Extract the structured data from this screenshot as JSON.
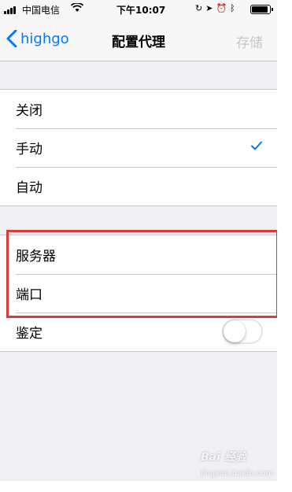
{
  "status_bar": {
    "carrier": "中国电信",
    "time": "下午10:07",
    "icons": [
      "orientation-lock-icon",
      "location-icon",
      "alarm-icon",
      "bluetooth-icon"
    ],
    "battery_level": 0.9
  },
  "nav": {
    "back_label": "highgo",
    "title": "配置代理",
    "save_label": "存储"
  },
  "proxy_modes": [
    {
      "label": "关闭",
      "selected": false
    },
    {
      "label": "手动",
      "selected": true
    },
    {
      "label": "自动",
      "selected": false
    }
  ],
  "manual_fields": {
    "server_label": "服务器",
    "port_label": "端口",
    "auth_label": "鉴定",
    "auth_enabled": false
  },
  "watermark": {
    "logo": "Bai 经验",
    "url": "jingyan.baidu.com"
  },
  "colors": {
    "accent": "#007aff",
    "highlight": "#e0393a",
    "background": "#efeff4"
  }
}
